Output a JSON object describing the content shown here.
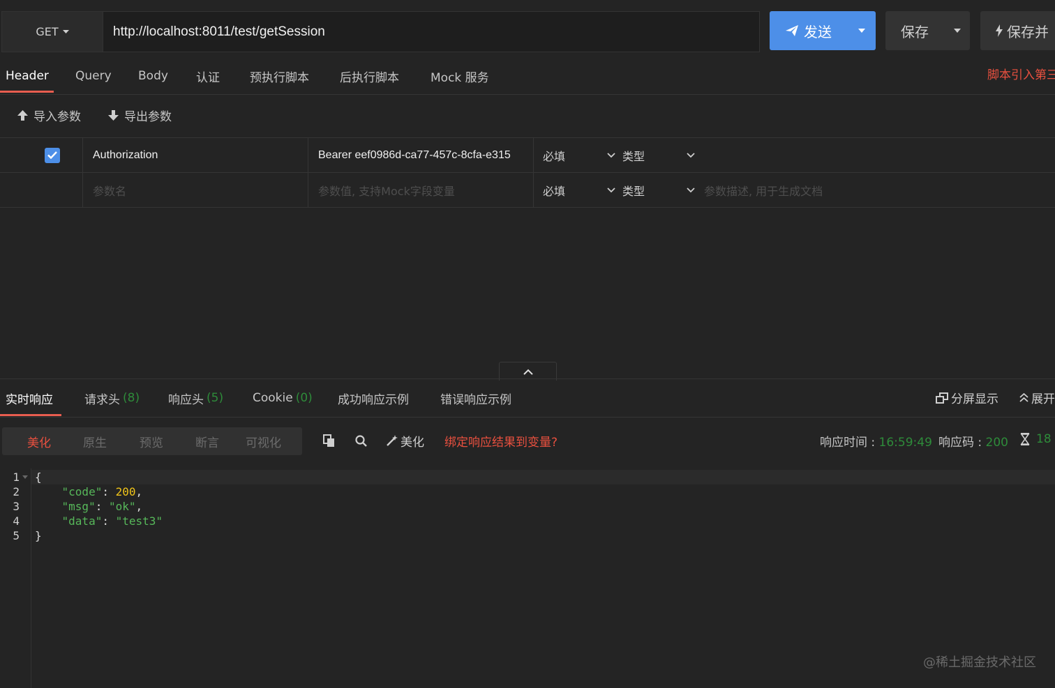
{
  "request": {
    "method": "GET",
    "url": "http://localhost:8011/test/getSession",
    "send_label": "发送",
    "save_label": "保存",
    "save_run_label": "保存并"
  },
  "req_tabs": [
    "Header",
    "Query",
    "Body",
    "认证",
    "预执行脚本",
    "后执行脚本",
    "Mock 服务"
  ],
  "script_link": "脚本引入第三",
  "import_label": "导入参数",
  "export_label": "导出参数",
  "params": {
    "row1": {
      "name": "Authorization",
      "value": "Bearer eef0986d-ca77-457c-8cfa-e315",
      "required": "必填",
      "type": "类型",
      "checked": true
    },
    "placeholder": {
      "name": "参数名",
      "value": "参数值, 支持Mock字段变量",
      "required": "必填",
      "type": "类型",
      "desc": "参数描述, 用于生成文档"
    }
  },
  "resp_tabs": [
    {
      "label": "实时响应",
      "count": ""
    },
    {
      "label": "请求头",
      "count": "(8)"
    },
    {
      "label": "响应头",
      "count": "(5)"
    },
    {
      "label": "Cookie",
      "count": "(0)"
    },
    {
      "label": "成功响应示例",
      "count": ""
    },
    {
      "label": "错误响应示例",
      "count": ""
    }
  ],
  "split_label": "分屏显示",
  "expand_label": "展开",
  "view_modes": [
    "美化",
    "原生",
    "预览",
    "断言",
    "可视化"
  ],
  "beautify_label": "美化",
  "bind_label": "绑定响应结果到变量?",
  "meta": {
    "time_label": "响应时间 : ",
    "time_value": "16:59:49",
    "code_label": "响应码 : ",
    "code_value": "200",
    "duration_value": "18"
  },
  "code": {
    "line_numbers": [
      "1",
      "2",
      "3",
      "4",
      "5"
    ],
    "open": "{",
    "close": "}",
    "k_code": "\"code\"",
    "v_code": "200",
    "k_msg": "\"msg\"",
    "v_msg": "\"ok\"",
    "k_data": "\"data\"",
    "v_data": "\"test3\""
  },
  "watermark": "@稀土掘金技术社区",
  "colors": {
    "accent": "#e85d4f",
    "primary": "#4d8fe8",
    "success": "#2e8b3a"
  }
}
